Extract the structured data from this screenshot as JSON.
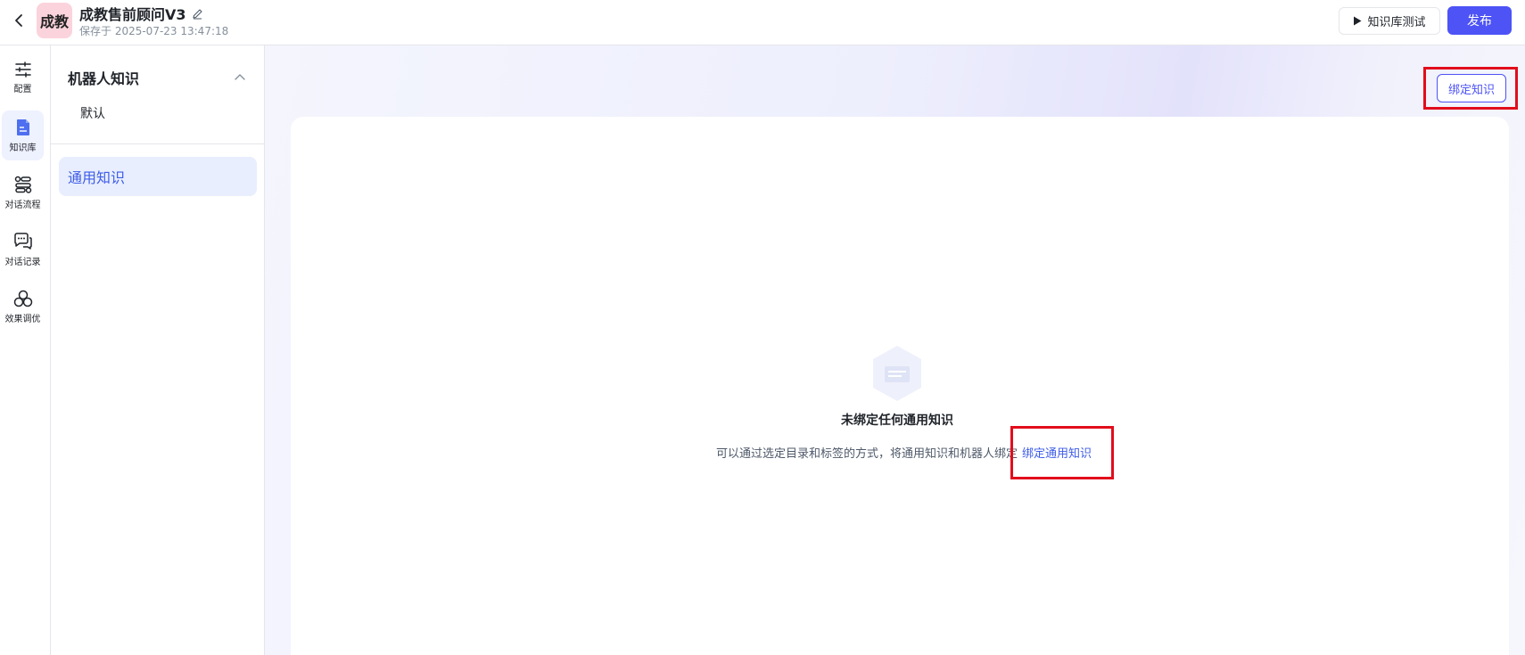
{
  "header": {
    "avatar_text": "成教",
    "title": "成教售前顾问V3",
    "saved_text": "保存于 2025-07-23 13:47:18",
    "test_button": "知识库测试",
    "publish_button": "发布"
  },
  "rail": {
    "items": [
      {
        "label": "配置",
        "icon": "sliders-icon"
      },
      {
        "label": "知识库",
        "icon": "knowledge-book-icon"
      },
      {
        "label": "对话流程",
        "icon": "flow-icon"
      },
      {
        "label": "对话记录",
        "icon": "chat-record-icon"
      },
      {
        "label": "效果调优",
        "icon": "tuning-icon"
      }
    ],
    "active": "知识库"
  },
  "knowledge_sidebar": {
    "group_title": "机器人知识",
    "default_item": "默认",
    "general_item": "通用知识"
  },
  "main": {
    "bind_button": "绑定知识",
    "empty_title": "未绑定任何通用知识",
    "empty_desc": "可以通过选定目录和标签的方式，将通用知识和机器人绑定",
    "empty_link": "绑定通用知识"
  },
  "colors": {
    "accent": "#4d53f5",
    "link": "#3e5ce8",
    "highlight": "#e20d1c",
    "avatar_bg": "#fbd3dc"
  }
}
